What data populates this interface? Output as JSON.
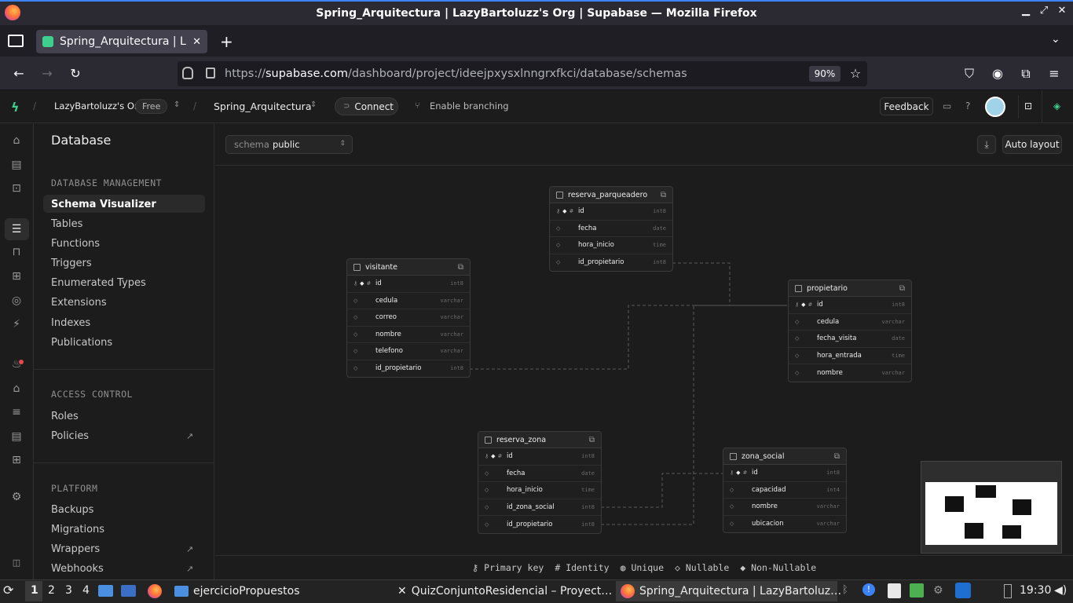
{
  "window": {
    "title": "Spring_Arquitectura | LazyBartoluzz's Org | Supabase — Mozilla Firefox"
  },
  "browser": {
    "tab_label": "Spring_Arquitectura | Laz",
    "url_prefix": "https://",
    "url_domain": "supabase.com",
    "url_path": "/dashboard/project/ideejpxysxlnngrxfkci/database/schemas",
    "zoom": "90%"
  },
  "header": {
    "org": "LazyBartoluzz's Org",
    "plan": "Free",
    "project": "Spring_Arquitectura",
    "connect": "Connect",
    "branching": "Enable branching",
    "feedback": "Feedback"
  },
  "sidebar": {
    "title": "Database",
    "sections": [
      {
        "heading": "DATABASE MANAGEMENT",
        "items": [
          "Schema Visualizer",
          "Tables",
          "Functions",
          "Triggers",
          "Enumerated Types",
          "Extensions",
          "Indexes",
          "Publications"
        ]
      },
      {
        "heading": "ACCESS CONTROL",
        "items": [
          "Roles",
          "Policies"
        ]
      },
      {
        "heading": "PLATFORM",
        "items": [
          "Backups",
          "Migrations",
          "Wrappers",
          "Webhooks"
        ]
      }
    ],
    "external_mark": "↗"
  },
  "toolbar": {
    "schema_label": "schema",
    "schema_value": "public",
    "auto_layout": "Auto layout"
  },
  "tables": [
    {
      "name": "reserva_parqueadero",
      "columns": [
        {
          "name": "id",
          "type": "int8",
          "pk": true
        },
        {
          "name": "fecha",
          "type": "date"
        },
        {
          "name": "hora_inicio",
          "type": "time"
        },
        {
          "name": "id_propietario",
          "type": "int8"
        }
      ]
    },
    {
      "name": "visitante",
      "columns": [
        {
          "name": "id",
          "type": "int8",
          "pk": true
        },
        {
          "name": "cedula",
          "type": "varchar"
        },
        {
          "name": "correo",
          "type": "varchar"
        },
        {
          "name": "nombre",
          "type": "varchar"
        },
        {
          "name": "telefono",
          "type": "varchar"
        },
        {
          "name": "id_propietario",
          "type": "int8"
        }
      ]
    },
    {
      "name": "propietario",
      "columns": [
        {
          "name": "id",
          "type": "int8",
          "pk": true
        },
        {
          "name": "cedula",
          "type": "varchar"
        },
        {
          "name": "fecha_visita",
          "type": "date"
        },
        {
          "name": "hora_entrada",
          "type": "time"
        },
        {
          "name": "nombre",
          "type": "varchar"
        }
      ]
    },
    {
      "name": "reserva_zona",
      "columns": [
        {
          "name": "id",
          "type": "int8",
          "pk": true
        },
        {
          "name": "fecha",
          "type": "date"
        },
        {
          "name": "hora_inicio",
          "type": "time"
        },
        {
          "name": "id_zona_social",
          "type": "int8"
        },
        {
          "name": "id_propietario",
          "type": "int8"
        }
      ]
    },
    {
      "name": "zona_social",
      "columns": [
        {
          "name": "id",
          "type": "int8",
          "pk": true
        },
        {
          "name": "capacidad",
          "type": "int4"
        },
        {
          "name": "nombre",
          "type": "varchar"
        },
        {
          "name": "ubicacion",
          "type": "varchar"
        }
      ]
    }
  ],
  "legend": [
    "Primary key",
    "Identity",
    "Unique",
    "Nullable",
    "Non-Nullable"
  ],
  "taskbar": {
    "workspaces": [
      "1",
      "2",
      "3",
      "4"
    ],
    "tasks": [
      "ejercicioPropuestos",
      "QuizConjuntoResidencial – Proyect…",
      "Spring_Arquitectura | LazyBartoluz…"
    ],
    "clock": "19:30"
  }
}
